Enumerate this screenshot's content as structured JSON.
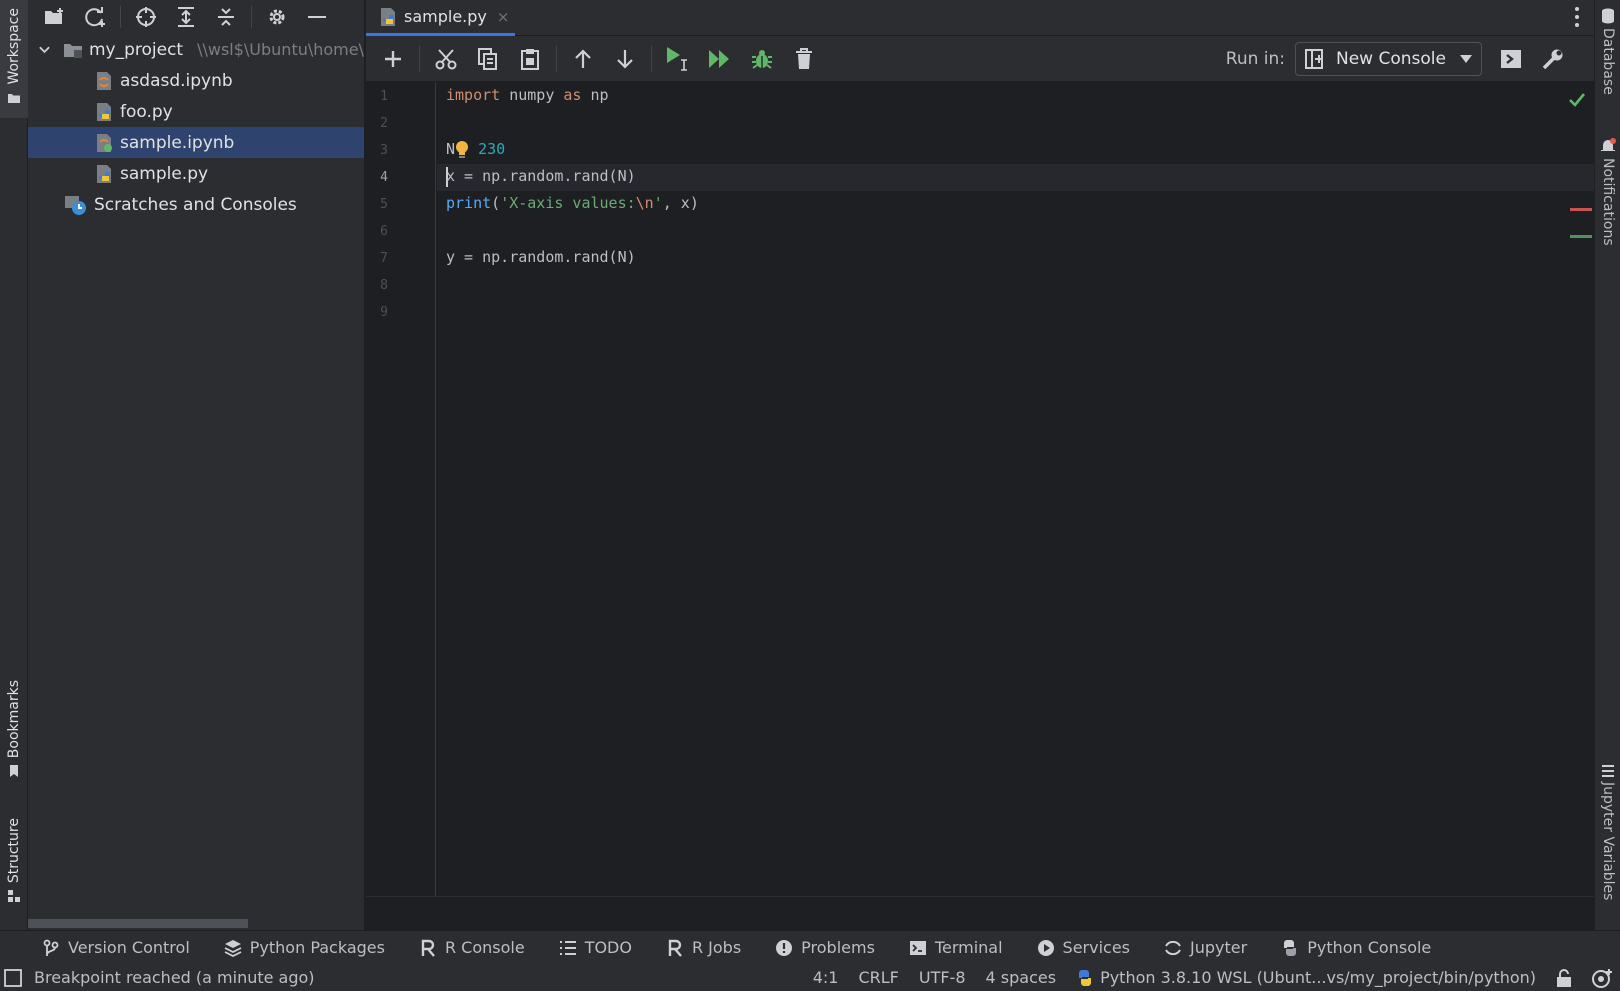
{
  "left_strip": {
    "workspace_label": "Workspace",
    "bookmarks_label": "Bookmarks",
    "structure_label": "Structure"
  },
  "right_strip": {
    "database_label": "Database",
    "notifications_label": "Notifications",
    "jupyter_variables_label": "Jupyter Variables"
  },
  "project": {
    "root": {
      "name": "my_project",
      "path": "\\\\wsl$\\Ubuntu\\home\\"
    },
    "files": [
      {
        "name": "asdasd.ipynb",
        "icon": "jupyter-notebook-icon"
      },
      {
        "name": "foo.py",
        "icon": "python-file-icon"
      },
      {
        "name": "sample.ipynb",
        "icon": "jupyter-notebook-running-icon",
        "selected": true
      },
      {
        "name": "sample.py",
        "icon": "python-file-icon"
      }
    ],
    "scratches": "Scratches and Consoles"
  },
  "editor_tab": {
    "label": "sample.py",
    "close": "×"
  },
  "toolbar": {
    "run_in_label": "Run in:",
    "console_value": "New Console"
  },
  "code": {
    "line_numbers": [
      "1",
      "2",
      "3",
      "4",
      "5",
      "6",
      "7",
      "8",
      "9"
    ],
    "current_line": 4,
    "l1": {
      "kw1": "import",
      "mod": " numpy ",
      "kw2": "as",
      "alias": " np"
    },
    "l3": {
      "name": "N",
      "num": "230"
    },
    "l4": {
      "name": "x",
      "rest": " = np.random.rand(N)"
    },
    "l5": {
      "fn": "print",
      "open": "(",
      "str1": "'X-axis values:",
      "esc": "\\n",
      "str2": "'",
      "rest": ", x)"
    },
    "l7": {
      "text": "y = np.random.rand(N)"
    }
  },
  "tool_windows": [
    {
      "label": "Version Control",
      "icon": "branch-icon"
    },
    {
      "label": "Python Packages",
      "icon": "layers-icon"
    },
    {
      "label": "R Console",
      "icon": "r-icon"
    },
    {
      "label": "TODO",
      "icon": "list-icon"
    },
    {
      "label": "R Jobs",
      "icon": "r-jobs-icon"
    },
    {
      "label": "Problems",
      "icon": "warning-icon"
    },
    {
      "label": "Terminal",
      "icon": "terminal-icon"
    },
    {
      "label": "Services",
      "icon": "play-circle-icon"
    },
    {
      "label": "Jupyter",
      "icon": "jupyter-icon"
    },
    {
      "label": "Python Console",
      "icon": "python-icon"
    }
  ],
  "status": {
    "message": "Breakpoint reached (a minute ago)",
    "position": "4:1",
    "line_sep": "CRLF",
    "encoding": "UTF-8",
    "indent": "4 spaces",
    "interpreter": "Python 3.8.10 WSL (Ubunt...vs/my_project/bin/python)"
  },
  "colors": {
    "accent": "#3574f0",
    "run_green": "#5fb865",
    "selection": "#2e436e"
  }
}
